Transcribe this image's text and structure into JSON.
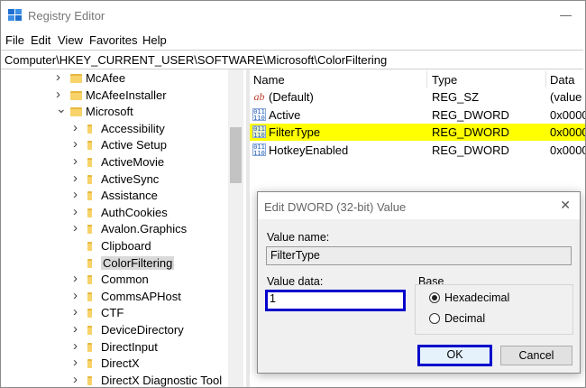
{
  "window": {
    "title": "Registry Editor",
    "min_glyph": "—"
  },
  "menu": [
    "File",
    "Edit",
    "View",
    "Favorites",
    "Help"
  ],
  "address": "Computer\\HKEY_CURRENT_USER\\SOFTWARE\\Microsoft\\ColorFiltering",
  "tree": {
    "items": [
      {
        "label": "McAfee",
        "chevron": ">"
      },
      {
        "label": "McAfeeInstaller",
        "chevron": ">"
      },
      {
        "label": "Microsoft",
        "chevron": "v"
      },
      {
        "label": "Accessibility",
        "chevron": ">"
      },
      {
        "label": "Active Setup",
        "chevron": ">"
      },
      {
        "label": "ActiveMovie",
        "chevron": ">"
      },
      {
        "label": "ActiveSync",
        "chevron": ">"
      },
      {
        "label": "Assistance",
        "chevron": ">"
      },
      {
        "label": "AuthCookies",
        "chevron": ">"
      },
      {
        "label": "Avalon.Graphics",
        "chevron": ">"
      },
      {
        "label": "Clipboard",
        "chevron": ""
      },
      {
        "label": "ColorFiltering",
        "chevron": ""
      },
      {
        "label": "Common",
        "chevron": ">"
      },
      {
        "label": "CommsAPHost",
        "chevron": ">"
      },
      {
        "label": "CTF",
        "chevron": ">"
      },
      {
        "label": "DeviceDirectory",
        "chevron": ">"
      },
      {
        "label": "DirectInput",
        "chevron": ">"
      },
      {
        "label": "DirectX",
        "chevron": ">"
      },
      {
        "label": "DirectX Diagnostic Tool",
        "chevron": ">"
      }
    ],
    "selected": "ColorFiltering"
  },
  "list": {
    "columns": [
      "Name",
      "Type",
      "Data"
    ],
    "rows": [
      {
        "icon": "string-value-icon",
        "glyph": "ab",
        "name": "(Default)",
        "type": "REG_SZ",
        "data": "(value"
      },
      {
        "icon": "binary-value-icon",
        "glyph": "011\n110",
        "name": "Active",
        "type": "REG_DWORD",
        "data": "0x0000"
      },
      {
        "icon": "binary-value-icon",
        "glyph": "011\n110",
        "name": "FilterType",
        "type": "REG_DWORD",
        "data": "0x0000"
      },
      {
        "icon": "binary-value-icon",
        "glyph": "011\n110",
        "name": "HotkeyEnabled",
        "type": "REG_DWORD",
        "data": "0x0000"
      }
    ],
    "highlight_color": "#ffff00"
  },
  "dialog": {
    "title": "Edit DWORD (32-bit) Value",
    "value_name_label": "Value name:",
    "value_name": "FilterType",
    "value_data_label": "Value data:",
    "value_data": "1",
    "base_label": "Base",
    "hex_label": "Hexadecimal",
    "dec_label": "Decimal",
    "selected_base": "Hexadecimal",
    "ok_label": "OK",
    "cancel_label": "Cancel",
    "close_glyph": "✕",
    "annotation_color": "#0000cc"
  }
}
